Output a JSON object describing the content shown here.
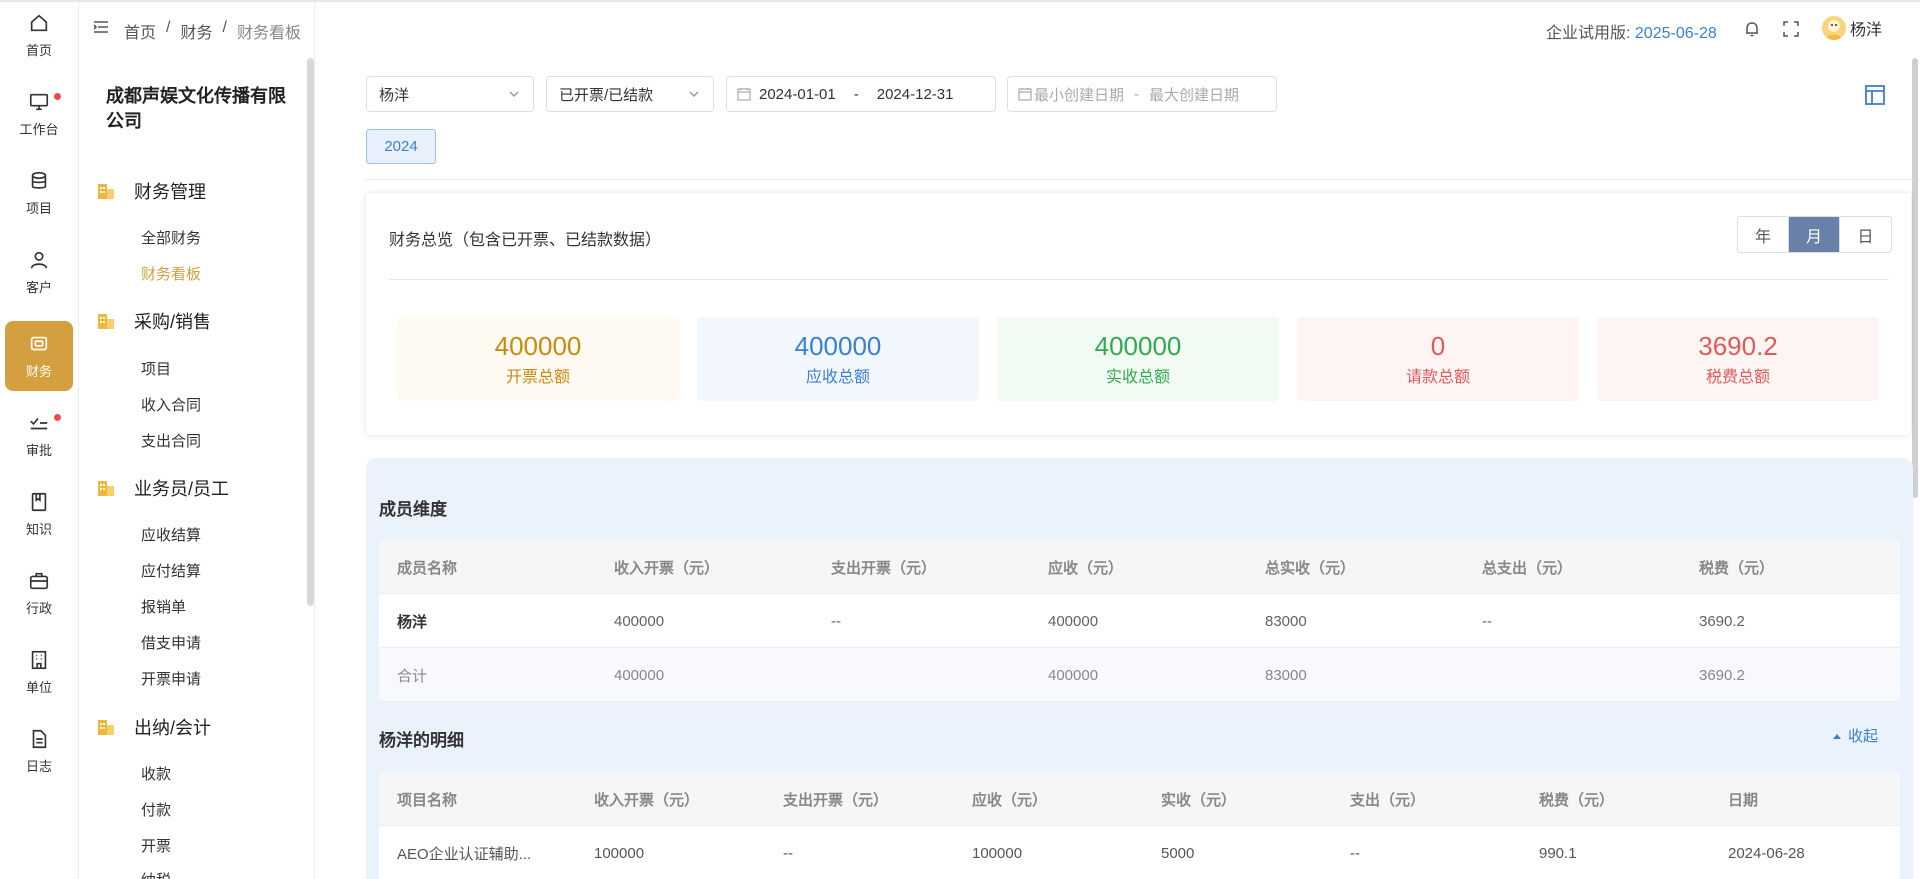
{
  "rail": [
    {
      "label": "首页",
      "icon": "home-icon"
    },
    {
      "label": "工作台",
      "icon": "monitor-icon",
      "dot": true
    },
    {
      "label": "项目",
      "icon": "database-icon"
    },
    {
      "label": "客户",
      "icon": "user-icon"
    },
    {
      "label": "财务",
      "icon": "wallet-icon",
      "active": true
    },
    {
      "label": "审批",
      "icon": "check-list-icon",
      "dot": true
    },
    {
      "label": "知识",
      "icon": "book-icon"
    },
    {
      "label": "行政",
      "icon": "briefcase-icon"
    },
    {
      "label": "单位",
      "icon": "building-icon"
    },
    {
      "label": "日志",
      "icon": "document-icon"
    }
  ],
  "sidebar": {
    "company": "成都声娱文化传播有限公司",
    "groups": [
      {
        "title": "财务管理",
        "items": [
          "全部财务",
          "财务看板"
        ]
      },
      {
        "title": "采购/销售",
        "items": [
          "项目",
          "收入合同",
          "支出合同"
        ]
      },
      {
        "title": "业务员/员工",
        "items": [
          "应收结算",
          "应付结算",
          "报销单",
          "借支申请",
          "开票申请"
        ]
      },
      {
        "title": "出纳/会计",
        "items": [
          "收款",
          "付款",
          "开票",
          "纳税"
        ]
      }
    ],
    "active_item": "财务看板"
  },
  "header": {
    "breadcrumb": [
      "首页",
      "财务",
      "财务看板"
    ],
    "trial_label": "企业试用版:",
    "trial_date": "2025-06-28",
    "user_name": "杨洋"
  },
  "filters": {
    "member": "杨洋",
    "status": "已开票/已结款",
    "date_start": "2024-01-01",
    "date_sep": "-",
    "date_end": "2024-12-31",
    "create_start_placeholder": "最小创建日期",
    "create_sep": "-",
    "create_end_placeholder": "最大创建日期",
    "year_tag": "2024"
  },
  "overview": {
    "title": "财务总览（包含已开票、已结款数据）",
    "granularity": [
      "年",
      "月",
      "日"
    ],
    "granularity_selected": "月",
    "stats": [
      {
        "value": "400000",
        "label": "开票总额",
        "color": "#c98a12",
        "bg": "#fffaf1"
      },
      {
        "value": "400000",
        "label": "应收总额",
        "color": "#3a7fd6",
        "bg": "#f2f7fe"
      },
      {
        "value": "400000",
        "label": "实收总额",
        "color": "#34a853",
        "bg": "#f1faf3"
      },
      {
        "value": "0",
        "label": "请款总额",
        "color": "#e05a5a",
        "bg": "#fff4f4"
      },
      {
        "value": "3690.2",
        "label": "税费总额",
        "color": "#e05a5a",
        "bg": "#fff4f4"
      }
    ]
  },
  "member_table": {
    "title": "成员维度",
    "columns": [
      "成员名称",
      "收入开票（元）",
      "支出开票（元）",
      "应收（元）",
      "总实收（元）",
      "总支出（元）",
      "税费（元）"
    ],
    "rows": [
      [
        "杨洋",
        "400000",
        "--",
        "400000",
        "83000",
        "--",
        "3690.2"
      ],
      [
        "合计",
        "400000",
        "",
        "400000",
        "83000",
        "",
        "3690.2"
      ]
    ]
  },
  "detail_table": {
    "title": "杨洋的明细",
    "collapse_label": "收起",
    "columns": [
      "项目名称",
      "收入开票（元）",
      "支出开票（元）",
      "应收（元）",
      "实收（元）",
      "支出（元）",
      "税费（元）",
      "日期"
    ],
    "rows": [
      [
        "AEO企业认证辅助...",
        "100000",
        "--",
        "100000",
        "5000",
        "--",
        "990.1",
        "2024-06-28"
      ]
    ]
  }
}
